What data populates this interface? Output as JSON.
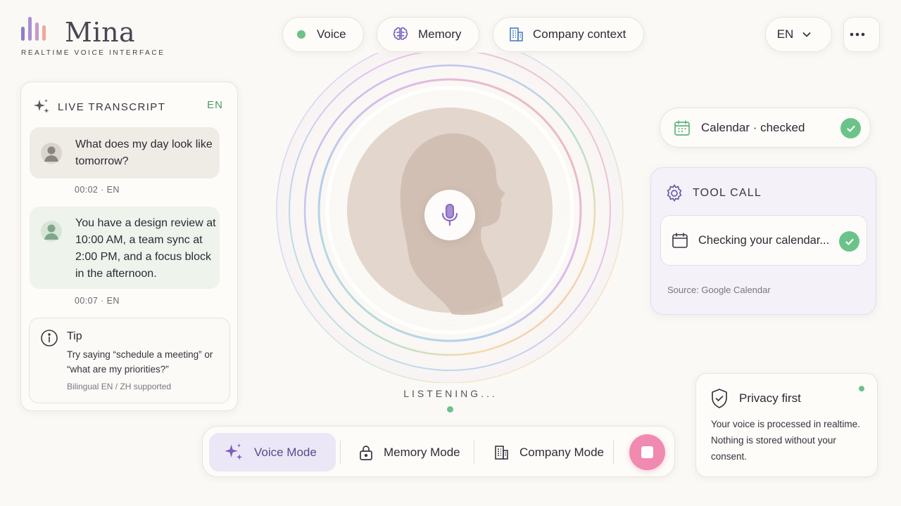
{
  "brand": {
    "name": "Mina",
    "tagline": "REALTIME VOICE INTERFACE",
    "bar_colors": [
      "#8f7cc9",
      "#a98fd3",
      "#e7a0b0",
      "#f2b08c"
    ]
  },
  "topbar": {
    "voice_label": "Voice",
    "memory_label": "Memory",
    "company_label": "Company context",
    "language": "EN",
    "more_icon": "more-horizontal-icon"
  },
  "transcript": {
    "title": "LIVE TRANSCRIPT",
    "language": "EN",
    "messages": [
      {
        "role": "user",
        "text": "What does my day look like tomorrow?",
        "meta": "00:02 · EN"
      },
      {
        "role": "assistant",
        "text": "You have a design review at 10:00 AM, a team sync at 2:00 PM, and a focus block in the afternoon.",
        "meta": "00:07 · EN"
      }
    ],
    "tip": {
      "title": "Tip",
      "body": "Try saying “schedule a meeting” or “what are my priorities?”",
      "footer": "Bilingual EN / ZH supported"
    }
  },
  "center": {
    "status": "LISTENING...",
    "mic_icon": "microphone-icon"
  },
  "modes": {
    "voice": "Voice Mode",
    "memory": "Memory Mode",
    "company": "Company Mode",
    "stop_icon": "stop-icon"
  },
  "calendar_status": {
    "label": "Calendar · checked"
  },
  "tool_call": {
    "title": "TOOL CALL",
    "action": "Checking your calendar...",
    "source": "Source: Google Calendar"
  },
  "privacy": {
    "title": "Privacy first",
    "body": "Your voice is processed in realtime. Nothing is stored without your consent."
  },
  "colors": {
    "accent_purple": "#8b6cc8",
    "success_green": "#6bc38a",
    "stop_pink": "#f08ab0",
    "background": "#fbf9f5"
  }
}
